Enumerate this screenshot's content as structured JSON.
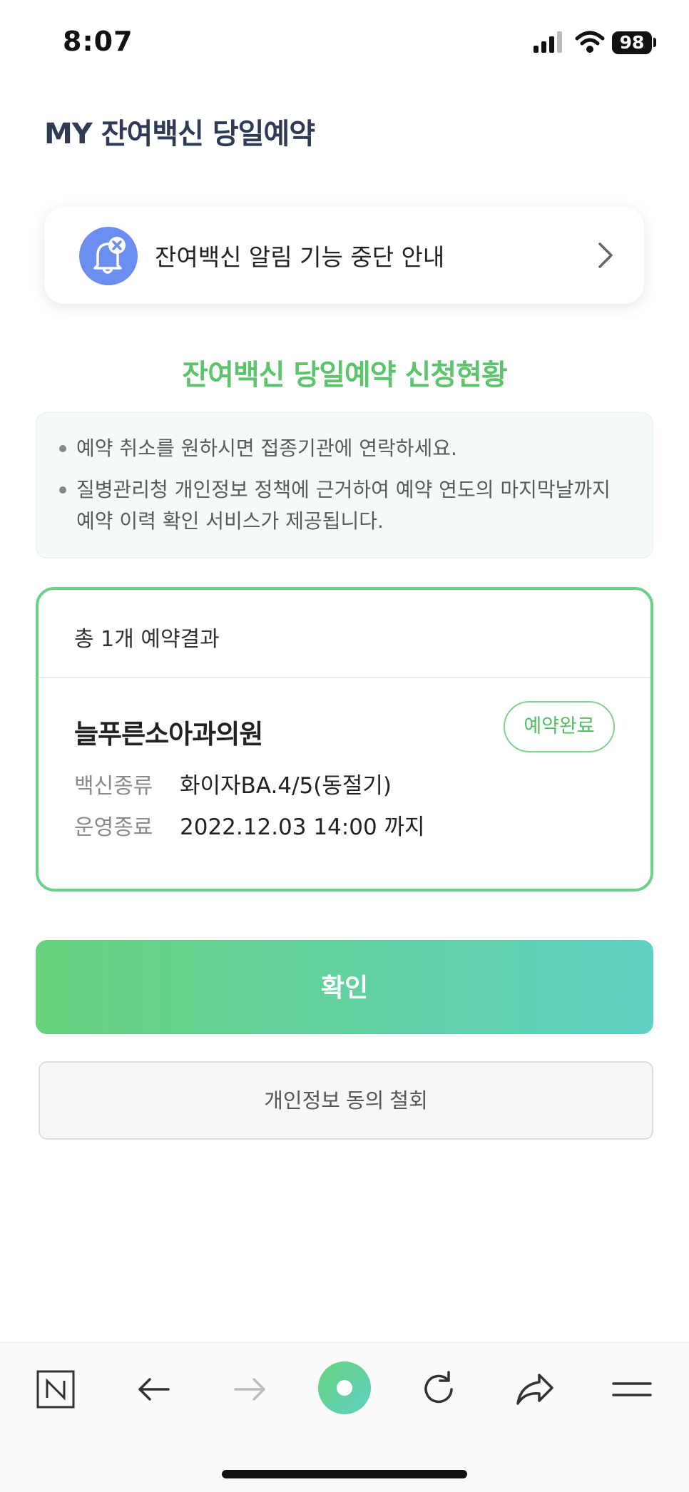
{
  "status_bar": {
    "time": "8:07",
    "battery": "98"
  },
  "page_title": "MY 잔여백신 당일예약",
  "notice": {
    "text": "잔여백신 알림 기능 중단 안내"
  },
  "section_title": "잔여백신 당일예약 신청현황",
  "info": {
    "line1": "예약 취소를 원하시면 접종기관에 연락하세요.",
    "line2a": "질병관리청 개인정보 정책에 근거하여 예약 연도의 마지막날까지",
    "line2b": "예약 이력 확인 서비스가 제공됩니다."
  },
  "result": {
    "count_text": "총 1개 예약결과",
    "clinic_name": "늘푸른소아과의원",
    "status_badge": "예약완료",
    "vaccine_label": "백신종류",
    "vaccine_value": "화이자BA.4/5(동절기)",
    "operation_label": "운영종료",
    "operation_value": "2022.12.03 14:00 까지"
  },
  "buttons": {
    "confirm": "확인",
    "withdraw": "개인정보 동의 철회"
  },
  "colors": {
    "brand_green": "#5cc46b",
    "gradient_start": "#67d37d",
    "gradient_end": "#5fd0c3",
    "bell_blue": "#6b8ef0"
  }
}
